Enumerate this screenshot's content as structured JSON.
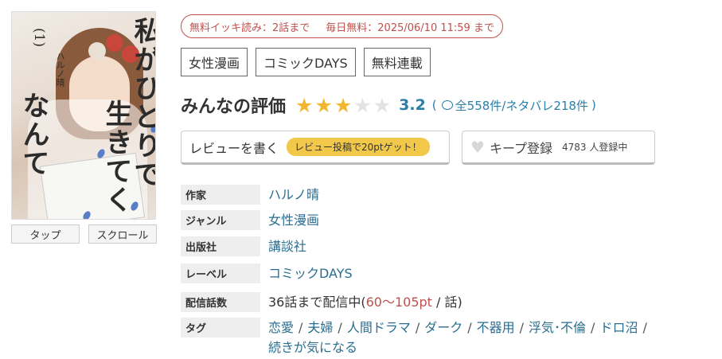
{
  "cover": {
    "title_line1": "私がひとりで",
    "title_line2": "生きてく",
    "title_line3": "なんて",
    "volume": "(1)",
    "author": "ハルノ晴"
  },
  "view_buttons": [
    "タップ",
    "スクロール"
  ],
  "free_banner": {
    "ikki": "無料イッキ読み：2話まで",
    "daily": "毎日無料：2025/06/10 11:59 まで"
  },
  "top_tags": [
    "女性漫画",
    "コミックDAYS",
    "無料連載"
  ],
  "rating": {
    "heading": "みんなの評価",
    "stars_filled": 3,
    "stars_total": 5,
    "score": "3.2",
    "open_paren": "(",
    "count_text": "全558件/ネタバレ218件",
    "close_paren": ")"
  },
  "review_button": {
    "label": "レビューを書く",
    "promo": "レビュー投稿で20ptゲット！"
  },
  "keep_button": {
    "label": "キープ登録",
    "count": "4783 人登録中"
  },
  "info": {
    "author_label": "作家",
    "author_value": "ハルノ晴",
    "genre_label": "ジャンル",
    "genre_value": "女性漫画",
    "publisher_label": "出版社",
    "publisher_value": "講談社",
    "label_label": "レーベル",
    "label_value": "コミックDAYS",
    "episodes_label": "配信話数",
    "episodes_prefix": "36話まで配信中(",
    "episodes_price": "60〜105pt",
    "episodes_suffix": " / 話)",
    "tags_label": "タグ",
    "tags": [
      "恋愛",
      "夫婦",
      "人間ドラマ",
      "ダーク",
      "不器用",
      "浮気･不倫",
      "ドロ沼",
      "続きが気になる"
    ]
  },
  "colors": {
    "link": "#2a6d8f",
    "accent_red": "#c0504d",
    "star": "#f2b72e",
    "promo_yellow": "#f2c84b"
  }
}
